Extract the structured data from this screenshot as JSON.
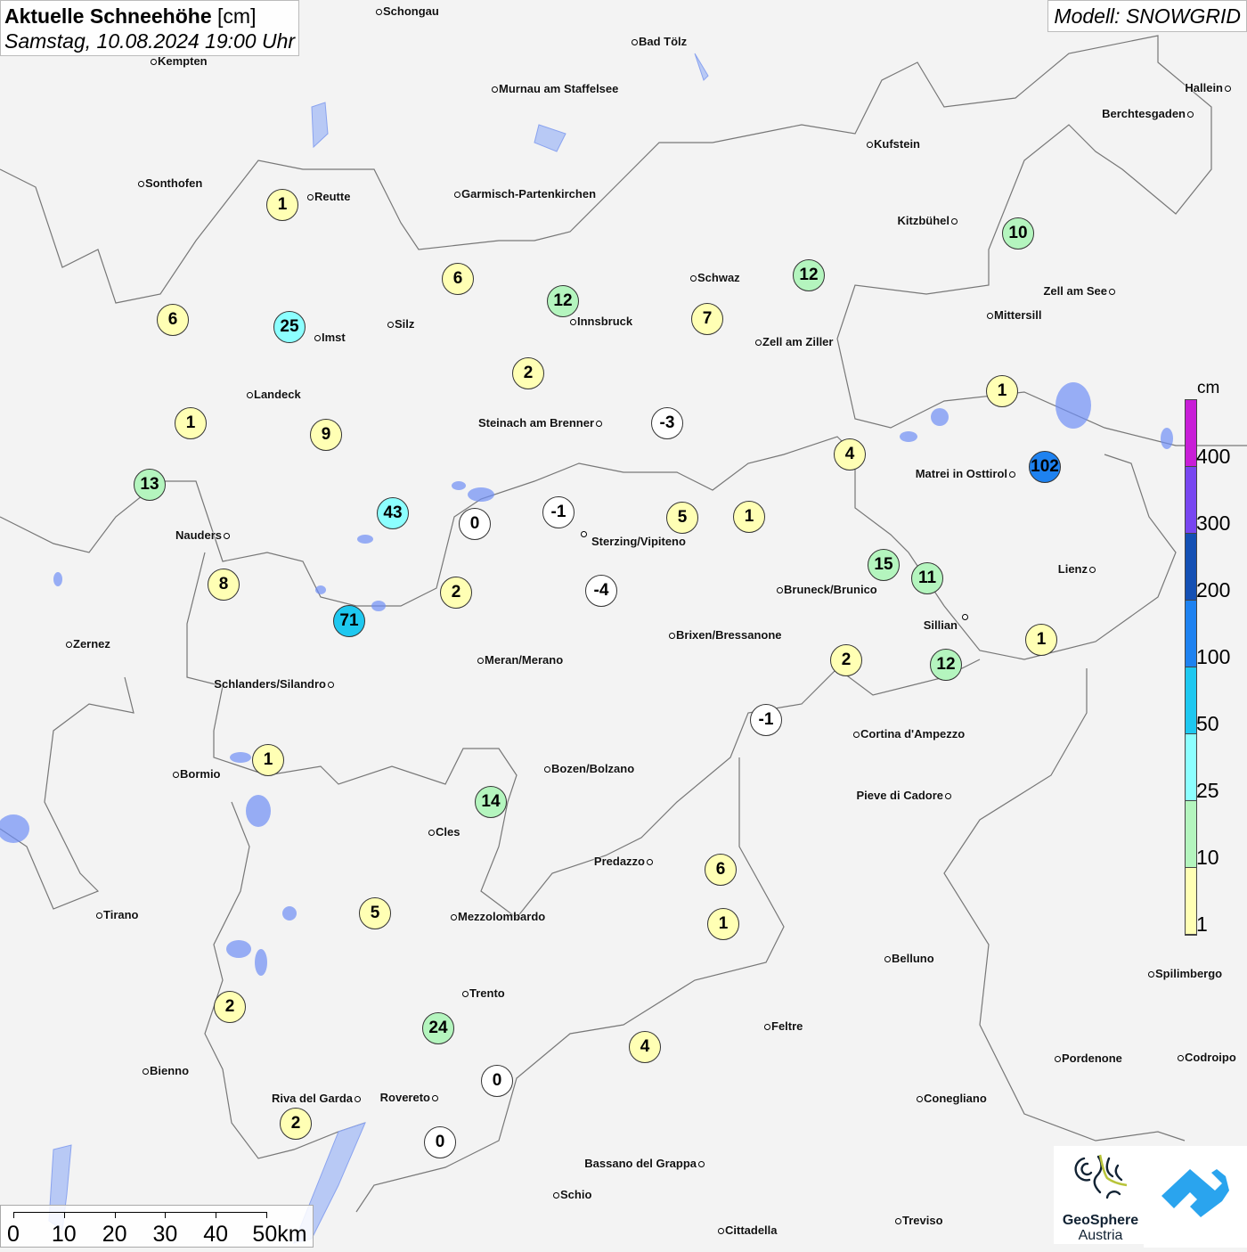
{
  "header": {
    "title": "Aktuelle Schneehöhe",
    "unit": "[cm]",
    "datetime": "Samstag, 10.08.2024 19:00 Uhr",
    "model": "Modell: SNOWGRID"
  },
  "legend": {
    "unit": "cm",
    "classes": [
      {
        "label": "400",
        "color": "#c81ed7"
      },
      {
        "label": "300",
        "color": "#7846f0"
      },
      {
        "label": "200",
        "color": "#1450b4"
      },
      {
        "label": "100",
        "color": "#1e82f0"
      },
      {
        "label": "50",
        "color": "#1ec8f0"
      },
      {
        "label": "25",
        "color": "#8cffff"
      },
      {
        "label": "10",
        "color": "#b4f5be"
      },
      {
        "label": "1",
        "color": "#ffffb4"
      }
    ]
  },
  "scale_bar": {
    "labels": [
      "0",
      "10",
      "20",
      "30",
      "40",
      "50km"
    ]
  },
  "logos": {
    "geosphere": "GeoSphere Austria",
    "geosphere_line1": "GeoSphere",
    "geosphere_line2": "Austria"
  },
  "cities": [
    "Schongau",
    "Bad Tölz",
    "Kempten",
    "Murnau am Staffelsee",
    "Hallein",
    "Berchtesgaden",
    "Kufstein",
    "Sonthofen",
    "Reutte",
    "Garmisch-Partenkirchen",
    "Kitzbühel",
    "Schwaz",
    "Zell am See",
    "Mittersill",
    "Innsbruck",
    "Silz",
    "Imst",
    "Zell am Ziller",
    "Landeck",
    "Steinach am Brenner",
    "Matrei in Osttirol",
    "Nauders",
    "Sterzing/Vipiteno",
    "Lienz",
    "Bruneck/Brunico",
    "Sillian",
    "Brixen/Bressanone",
    "Zernez",
    "Meran/Merano",
    "Schlanders/Silandro",
    "Cortina d'Ampezzo",
    "Bozen/Bolzano",
    "Bormio",
    "Pieve di Cadore",
    "Cles",
    "Predazzo",
    "Tirano",
    "Mezzolombardo",
    "Belluno",
    "Spilimbergo",
    "Trento",
    "Feltre",
    "Pordenone",
    "Codroipo",
    "Bienno",
    "Riva del Garda",
    "Rovereto",
    "Conegliano",
    "Bassano del Grappa",
    "Schio",
    "Treviso",
    "Cittadella"
  ],
  "snow_values": [
    1,
    6,
    12,
    12,
    10,
    6,
    25,
    7,
    2,
    1,
    1,
    9,
    -3,
    4,
    102,
    13,
    43,
    0,
    -1,
    5,
    1,
    15,
    11,
    8,
    2,
    -4,
    71,
    1,
    2,
    12,
    -1,
    1,
    14,
    6,
    5,
    1,
    2,
    24,
    4,
    0,
    2,
    0
  ]
}
